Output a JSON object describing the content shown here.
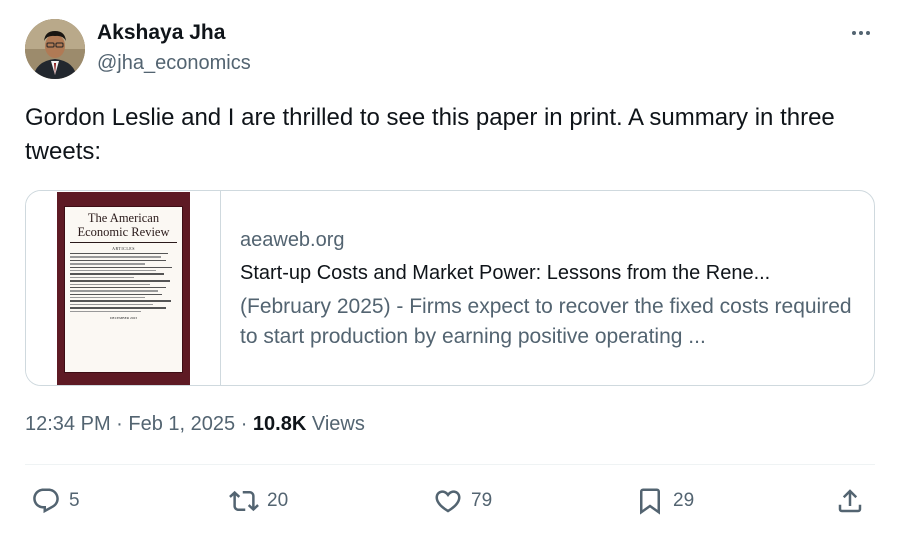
{
  "author": {
    "name": "Akshaya Jha",
    "handle": "@jha_economics"
  },
  "tweet": {
    "text": "Gordon Leslie and I are thrilled to see this paper in print. A summary in three tweets:"
  },
  "card": {
    "domain": "aeaweb.org",
    "title": "Start-up Costs and Market Power: Lessons from the Rene...",
    "description": "(February 2025) - Firms expect to recover the fixed costs required to start production by earning positive operating ...",
    "thumbnail": {
      "journal_title": "The American Economic Review",
      "section": "ARTICLES",
      "date": "DECEMBER 2023"
    }
  },
  "meta": {
    "time": "12:34 PM",
    "sep1": " · ",
    "date": "Feb 1, 2025",
    "sep2": " · ",
    "views_count": "10.8K",
    "views_label": " Views"
  },
  "actions": {
    "replies": "5",
    "reposts": "20",
    "likes": "79",
    "bookmarks": "29"
  },
  "icons": [
    "more-icon",
    "reply-icon",
    "repost-icon",
    "like-icon",
    "bookmark-icon",
    "share-icon"
  ],
  "colors": {
    "text": "#0f1419",
    "secondary": "#536471",
    "border": "#cfd9de",
    "journal_cover": "#5e1a24"
  }
}
